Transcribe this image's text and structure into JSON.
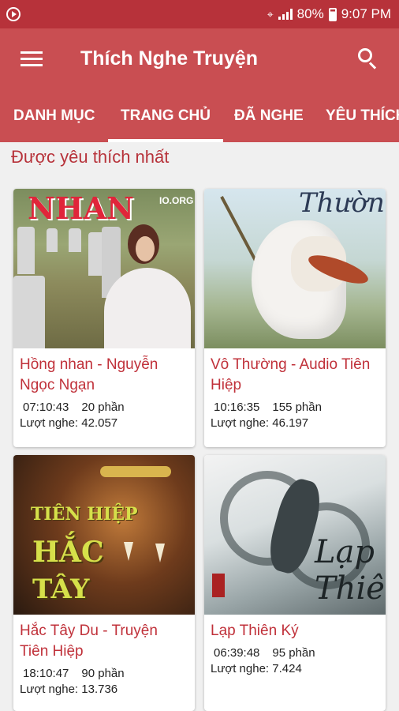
{
  "status_bar": {
    "battery": "80%",
    "time": "9:07 PM"
  },
  "app_bar": {
    "title": "Thích Nghe Truyện"
  },
  "tabs": [
    {
      "label": "DANH MỤC",
      "active": false
    },
    {
      "label": "TRANG CHỦ",
      "active": true
    },
    {
      "label": "ĐÃ NGHE",
      "active": false
    },
    {
      "label": "YÊU THÍCH",
      "active": false
    }
  ],
  "section": {
    "title": "Được yêu thích nhất"
  },
  "stories": [
    {
      "title": "Hồng nhan - Nguyễn Ngọc Ngạn",
      "duration": "07:10:43",
      "parts": "20 phần",
      "views": "Lượt nghe: 42.057",
      "cover_text": "NHAN",
      "cover_sub": "IO.ORG"
    },
    {
      "title": "Vô Thường - Audio Tiên Hiệp",
      "duration": "10:16:35",
      "parts": "155 phần",
      "views": "Lượt nghe: 46.197",
      "cover_text": "Thường"
    },
    {
      "title": "Hắc Tây Du - Truyện Tiên Hiệp",
      "duration": "18:10:47",
      "parts": "90 phần",
      "views": "Lượt nghe: 13.736",
      "cover_line1": "TIÊN HIỆP",
      "cover_line2": "HẮC",
      "cover_line3": "TÂY"
    },
    {
      "title": "Lạp Thiên Ký",
      "duration": "06:39:48",
      "parts": "95 phần",
      "views": "Lượt nghe: 7.424",
      "cover_text": "Lạp Thiên"
    }
  ],
  "colors": {
    "status_bar": "#b7323a",
    "app_bar": "#c94e52",
    "accent": "#c0313a"
  },
  "icons": {
    "menu": "menu-icon",
    "search": "search-icon"
  }
}
